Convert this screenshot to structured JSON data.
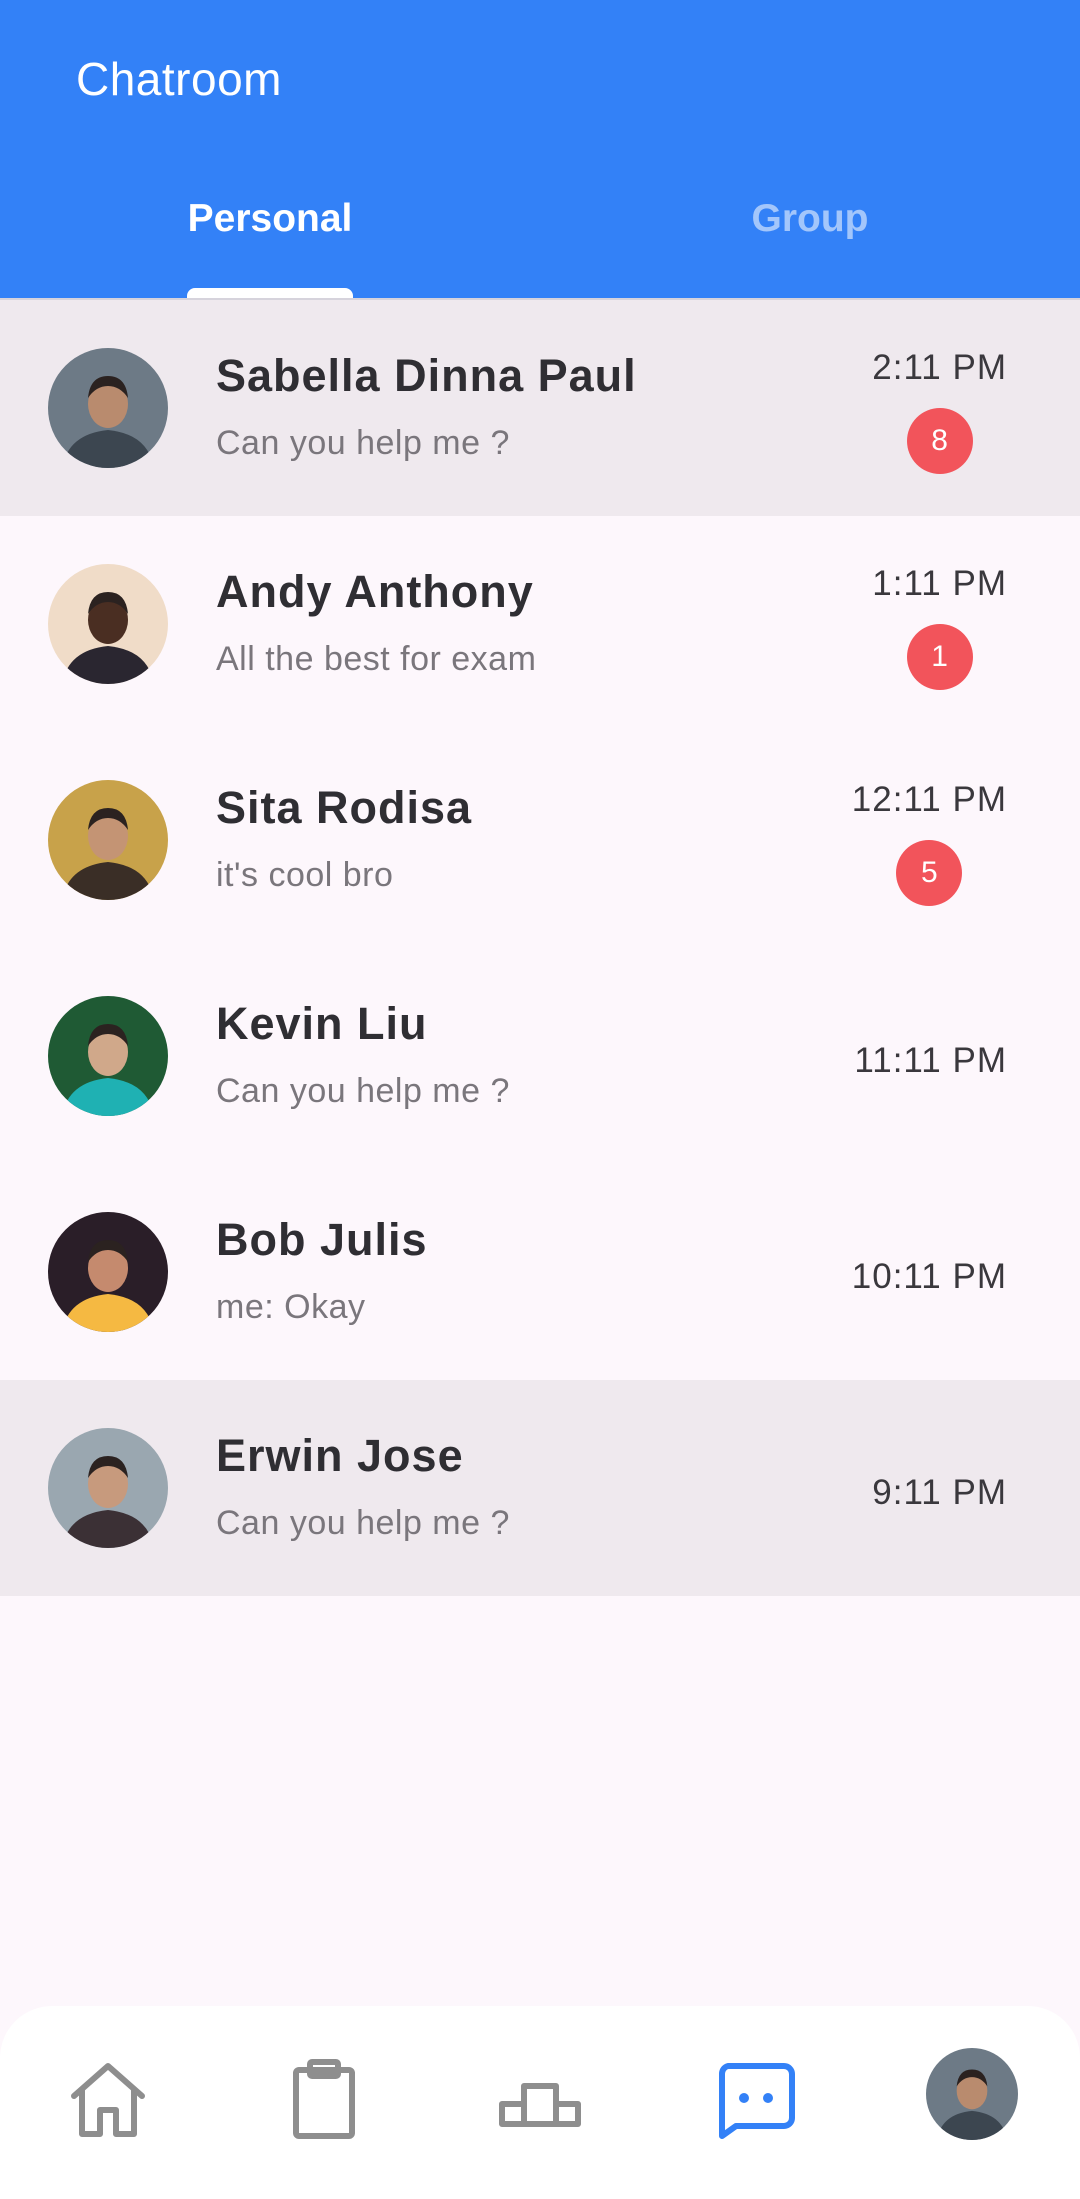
{
  "header": {
    "title": "Chatroom"
  },
  "tabs": [
    {
      "label": "Personal",
      "active": true
    },
    {
      "label": "Group",
      "active": false
    }
  ],
  "chats": [
    {
      "name": "Sabella Dinna Paul",
      "message": "Can you help me ?",
      "time": "2:11 PM",
      "unread": "8",
      "selected": true,
      "avatar_colors": [
        "#6d7a86",
        "#3c4650",
        "#b98b6e"
      ]
    },
    {
      "name": "Andy Anthony",
      "message": "All the best for exam",
      "time": "1:11 PM",
      "unread": "1",
      "selected": false,
      "avatar_colors": [
        "#f0dcc8",
        "#2a2630",
        "#4a2e22"
      ]
    },
    {
      "name": "Sita Rodisa",
      "message": "it's cool bro",
      "time": "12:11 PM",
      "unread": "5",
      "selected": false,
      "avatar_colors": [
        "#c8a24a",
        "#3a2e26",
        "#c49474"
      ]
    },
    {
      "name": "Kevin Liu",
      "message": "Can you help me ?",
      "time": "11:11 PM",
      "unread": "",
      "selected": false,
      "avatar_colors": [
        "#1f5a34",
        "#1fb1b3",
        "#d0a88a"
      ]
    },
    {
      "name": "Bob Julis",
      "message": "me: Okay",
      "time": "10:11 PM",
      "unread": "",
      "selected": false,
      "avatar_colors": [
        "#2a1e28",
        "#f5b942",
        "#c58a6e"
      ]
    },
    {
      "name": "Erwin Jose",
      "message": "Can you help me ?",
      "time": "9:11 PM",
      "unread": "",
      "selected": true,
      "avatar_colors": [
        "#9aa7b0",
        "#3b3035",
        "#c79a7d"
      ]
    }
  ],
  "bottom_nav": {
    "items": [
      {
        "name": "home-icon",
        "active": false
      },
      {
        "name": "clipboard-icon",
        "active": false
      },
      {
        "name": "podium-icon",
        "active": false
      },
      {
        "name": "chat-icon",
        "active": true
      },
      {
        "name": "profile-avatar",
        "active": false
      }
    ],
    "active_color": "#3381f7",
    "inactive_color": "#8e8e8e"
  },
  "colors": {
    "primary": "#3381f7",
    "badge": "#f2545b",
    "selected_row": "#efe9ee",
    "background": "#fdf7fc"
  }
}
